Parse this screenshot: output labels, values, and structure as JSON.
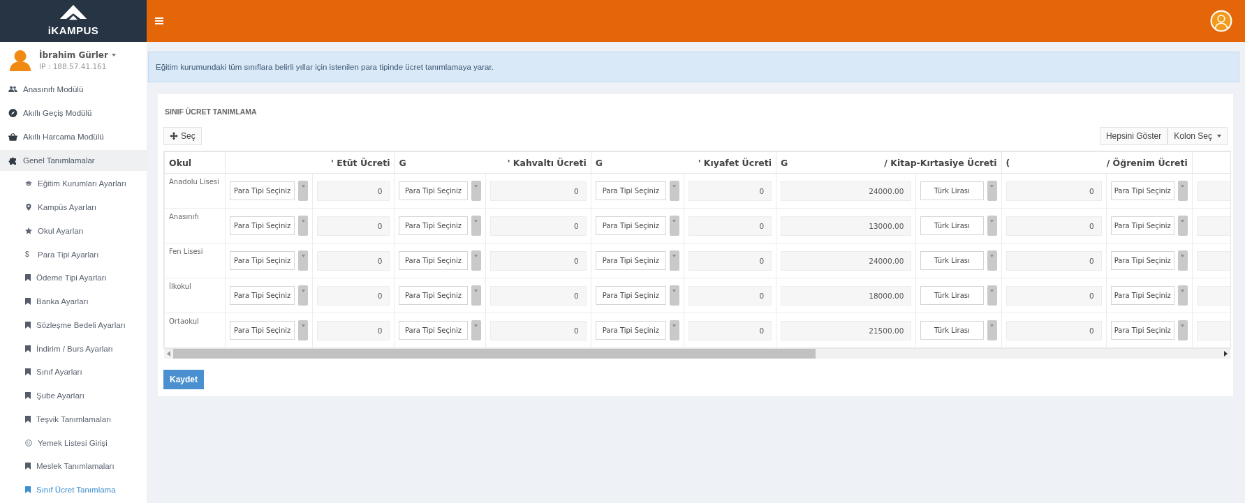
{
  "brand": {
    "name": "iKAMPUS"
  },
  "user": {
    "name": "İbrahim Gürler",
    "ip": "IP : 188.57.41.161"
  },
  "sidebar": {
    "items": [
      {
        "label": "Anasınıfı Modülü",
        "kind": "users",
        "selected": false,
        "expanded": false
      },
      {
        "label": "Akıllı Geçiş Modülü",
        "kind": "compass",
        "selected": false,
        "expanded": false
      },
      {
        "label": "Akıllı Harcama Modülü",
        "kind": "basket",
        "selected": false,
        "expanded": false
      },
      {
        "label": "Genel Tanımlamalar",
        "kind": "puzzle",
        "selected": false,
        "expanded": true,
        "children": [
          {
            "label": "Eğitim Kurumları Ayarları",
            "kind": "cap",
            "selected": false
          },
          {
            "label": "Kampüs Ayarları",
            "kind": "pin",
            "selected": false
          },
          {
            "label": "Okul Ayarları",
            "kind": "star",
            "selected": false
          },
          {
            "label": "Para Tipi Ayarları",
            "kind": "glyph",
            "glyph": "$",
            "selected": false
          },
          {
            "label": "Ödeme Tipi Ayarları",
            "kind": "bookmark",
            "selected": false
          },
          {
            "label": "Banka Ayarları",
            "kind": "bookmark",
            "selected": false
          },
          {
            "label": "Sözleşme Bedeli Ayarları",
            "kind": "bookmark",
            "selected": false
          },
          {
            "label": "İndirim / Burs Ayarları",
            "kind": "bookmark",
            "selected": false
          },
          {
            "label": "Sınıf Ayarları",
            "kind": "bookmark",
            "selected": false
          },
          {
            "label": "Şube Ayarları",
            "kind": "bookmark",
            "selected": false
          },
          {
            "label": "Teşvik Tanımlamaları",
            "kind": "bookmark",
            "selected": false
          },
          {
            "label": "Yemek Listesi Girişi",
            "kind": "smile",
            "selected": false
          },
          {
            "label": "Meslek Tanımlamaları",
            "kind": "bookmark",
            "selected": false
          },
          {
            "label": "Sınıf Ücret Tanımlama",
            "kind": "bookmark",
            "selected": true
          }
        ]
      }
    ]
  },
  "info": "Eğitim kurumundaki tüm sınıflara belirli yıllar için istenilen para tipinde ücret tanımlamaya yarar.",
  "card": {
    "title": "SINIF ÜCRET TANIMLAMA",
    "select_button": "Seç",
    "show_all_button": "Hepsini Göster",
    "columns_button": "Kolon Seç"
  },
  "table": {
    "first_column": "Okul",
    "groups": [
      {
        "right": "' Etüt Ücreti"
      },
      {
        "left": "G",
        "right": "' Kahvaltı Ücreti"
      },
      {
        "left": "G",
        "right": "' Kıyafet Ücreti"
      },
      {
        "left": "G",
        "right": "/ Kitap-Kırtasiye Ücreti"
      },
      {
        "left": "(",
        "right": "/ Öğrenim Ücreti"
      }
    ],
    "rows": [
      {
        "okul": "Anadolu Lisesi",
        "cells": [
          {
            "kind": "select",
            "value": "Para Tipi Seçiniz"
          },
          {
            "kind": "amount",
            "value": "0"
          },
          {
            "kind": "select",
            "value": "Para Tipi Seçiniz"
          },
          {
            "kind": "amount",
            "value": "0"
          },
          {
            "kind": "select",
            "value": "Para Tipi Seçiniz"
          },
          {
            "kind": "amount",
            "value": "0"
          },
          {
            "kind": "amount",
            "value": "24000.00"
          },
          {
            "kind": "select",
            "value": "Türk Lirası"
          },
          {
            "kind": "amount",
            "value": "0"
          },
          {
            "kind": "select",
            "value": "Para Tipi Seçiniz"
          }
        ]
      },
      {
        "okul": "Anasınıfı",
        "cells": [
          {
            "kind": "select",
            "value": "Para Tipi Seçiniz"
          },
          {
            "kind": "amount",
            "value": "0"
          },
          {
            "kind": "select",
            "value": "Para Tipi Seçiniz"
          },
          {
            "kind": "amount",
            "value": "0"
          },
          {
            "kind": "select",
            "value": "Para Tipi Seçiniz"
          },
          {
            "kind": "amount",
            "value": "0"
          },
          {
            "kind": "amount",
            "value": "13000.00"
          },
          {
            "kind": "select",
            "value": "Türk Lirası"
          },
          {
            "kind": "amount",
            "value": "0"
          },
          {
            "kind": "select",
            "value": "Para Tipi Seçiniz"
          }
        ]
      },
      {
        "okul": "Fen Lisesi",
        "cells": [
          {
            "kind": "select",
            "value": "Para Tipi Seçiniz"
          },
          {
            "kind": "amount",
            "value": "0"
          },
          {
            "kind": "select",
            "value": "Para Tipi Seçiniz"
          },
          {
            "kind": "amount",
            "value": "0"
          },
          {
            "kind": "select",
            "value": "Para Tipi Seçiniz"
          },
          {
            "kind": "amount",
            "value": "0"
          },
          {
            "kind": "amount",
            "value": "24000.00"
          },
          {
            "kind": "select",
            "value": "Türk Lirası"
          },
          {
            "kind": "amount",
            "value": "0"
          },
          {
            "kind": "select",
            "value": "Para Tipi Seçiniz"
          }
        ]
      },
      {
        "okul": "İlkokul",
        "cells": [
          {
            "kind": "select",
            "value": "Para Tipi Seçiniz"
          },
          {
            "kind": "amount",
            "value": "0"
          },
          {
            "kind": "select",
            "value": "Para Tipi Seçiniz"
          },
          {
            "kind": "amount",
            "value": "0"
          },
          {
            "kind": "select",
            "value": "Para Tipi Seçiniz"
          },
          {
            "kind": "amount",
            "value": "0"
          },
          {
            "kind": "amount",
            "value": "18000.00"
          },
          {
            "kind": "select",
            "value": "Türk Lirası"
          },
          {
            "kind": "amount",
            "value": "0"
          },
          {
            "kind": "select",
            "value": "Para Tipi Seçiniz"
          }
        ]
      },
      {
        "okul": "Ortaokul",
        "cells": [
          {
            "kind": "select",
            "value": "Para Tipi Seçiniz"
          },
          {
            "kind": "amount",
            "value": "0"
          },
          {
            "kind": "select",
            "value": "Para Tipi Seçiniz"
          },
          {
            "kind": "amount",
            "value": "0"
          },
          {
            "kind": "select",
            "value": "Para Tipi Seçiniz"
          },
          {
            "kind": "amount",
            "value": "0"
          },
          {
            "kind": "amount",
            "value": "21500.00"
          },
          {
            "kind": "select",
            "value": "Türk Lirası"
          },
          {
            "kind": "amount",
            "value": "0"
          },
          {
            "kind": "select",
            "value": "Para Tipi Seçiniz"
          }
        ]
      }
    ]
  },
  "save_button": "Kaydet"
}
